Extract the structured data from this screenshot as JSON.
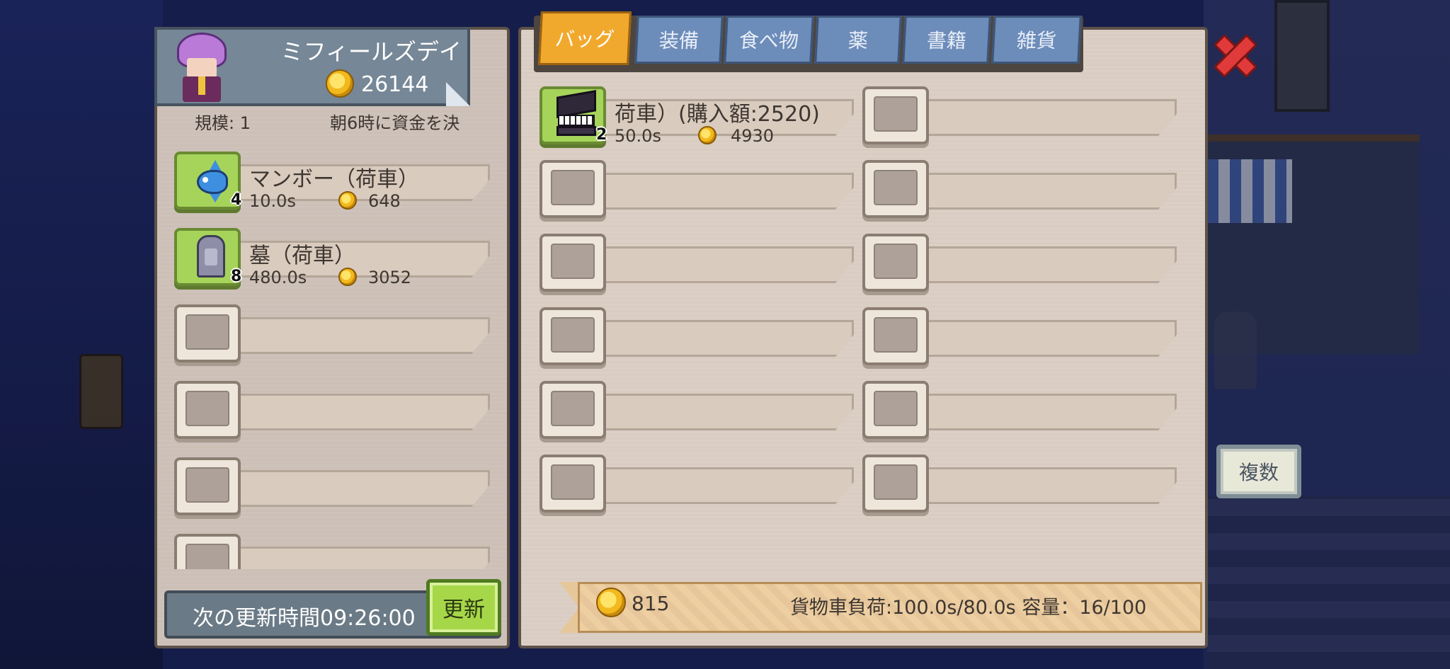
{
  "shop": {
    "name": "ミフィールズデイ",
    "money": "26144",
    "scale_label": "規模: 1",
    "fund_note": "朝6時に資金を決"
  },
  "stock": [
    {
      "name": "マンボー（荷車）",
      "qty": "4",
      "time": "10.0s",
      "price": "648",
      "icon": "sunfish-icon"
    },
    {
      "name": "墓（荷車）",
      "qty": "8",
      "time": "480.0s",
      "price": "3052",
      "icon": "grave-icon"
    },
    {
      "name": ""
    },
    {
      "name": ""
    },
    {
      "name": ""
    },
    {
      "name": ""
    }
  ],
  "refresh": {
    "label": "次の更新時間09:26:00",
    "button": "更新"
  },
  "tabs": [
    "バッグ",
    "装備",
    "食べ物",
    "薬",
    "書籍",
    "雑貨"
  ],
  "active_tab": "バッグ",
  "bag": [
    {
      "name": "荷車）(購入額:2520)",
      "qty": "2",
      "time": "50.0s",
      "price": "4930",
      "icon": "piano-icon"
    }
  ],
  "footer": {
    "money": "815",
    "load": "貨物車負荷:100.0s/80.0s 容量：16/100"
  },
  "buttons": {
    "multi": "複数"
  },
  "colors": {
    "active_tab": "#f1a92d",
    "inactive_tab": "#6c8cba",
    "close": "#e13a3a",
    "refresh_button": "#a6d748"
  }
}
